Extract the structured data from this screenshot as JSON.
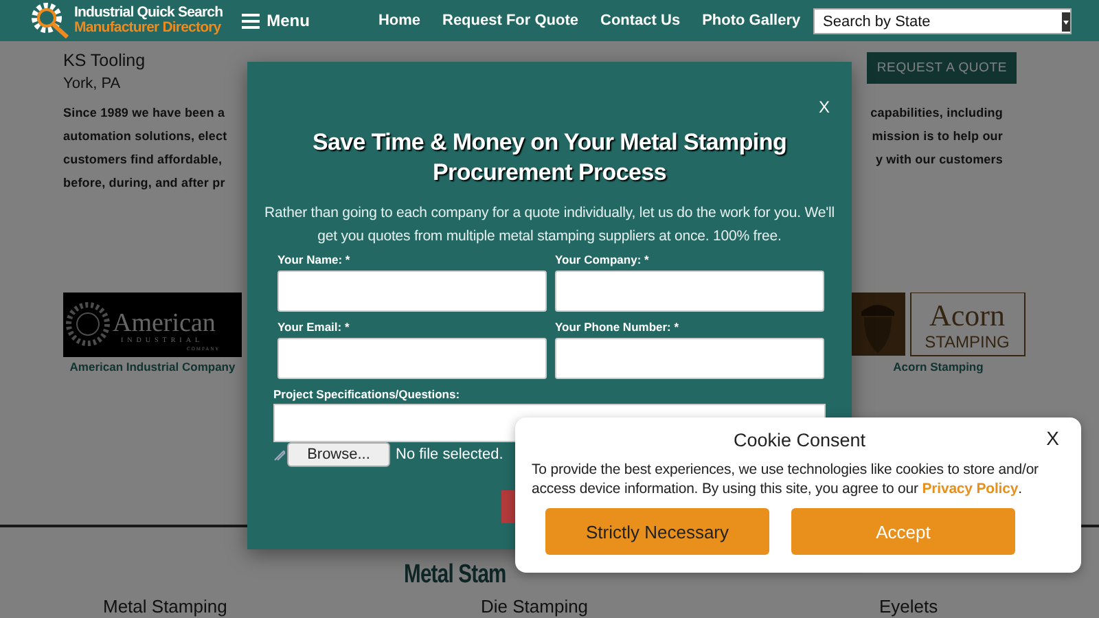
{
  "header": {
    "logo_line1": "Industrial Quick Search",
    "logo_line2": "Manufacturer Directory",
    "menu": "Menu",
    "nav": [
      "Home",
      "Request For Quote",
      "Contact Us",
      "Photo Gallery"
    ],
    "state_select": "Search by State"
  },
  "company": {
    "name": "KS Tooling",
    "location": "York, PA",
    "request_button": "REQUEST A QUOTE",
    "description_lines": [
      {
        "left": "Since 1989 we have been a",
        "right": "capabilities, including"
      },
      {
        "left": "automation solutions, elect",
        "right": "mission is to help our"
      },
      {
        "left": "customers find affordable,",
        "right": "y with our customers"
      },
      {
        "left": "before, during, and after pr"
      }
    ]
  },
  "logos": [
    {
      "kind": "american",
      "words": [
        "American",
        "INDUSTRIAL",
        "COMPANY"
      ],
      "caption": "American Industrial Company"
    },
    {
      "kind": "acorn",
      "words": [
        "Acorn",
        "STAMPING"
      ],
      "caption": "Acorn Stamping"
    }
  ],
  "section": {
    "heading": "Metal Stam",
    "categories": [
      "Metal Stamping",
      "Die Stamping",
      "Eyelets"
    ]
  },
  "modal": {
    "close": "X",
    "title": "Save Time & Money on Your Metal Stamping Procurement Process",
    "intro": "Rather than going to each company for a quote individually, let us do the work for you. We'll get you quotes from multiple metal stamping suppliers at once. 100% free.",
    "fields": [
      {
        "label": "Your Name: *"
      },
      {
        "label": "Your Company: *"
      },
      {
        "label": "Your Email: *"
      },
      {
        "label": "Your Phone Number: *"
      }
    ],
    "textarea_label": "Project Specifications/Questions:",
    "browse": "Browse...",
    "file_status": "No file selected."
  },
  "cookie": {
    "title": "Cookie Consent",
    "close": "X",
    "text_before": "To provide the best experiences, we use technologies like cookies to store and/or access device information. By using this site, you agree to our ",
    "link": "Privacy Policy",
    "text_after": ".",
    "buttons": [
      {
        "label": "Strictly Necessary",
        "kind": "secondary"
      },
      {
        "label": "Accept",
        "kind": "primary"
      }
    ]
  }
}
